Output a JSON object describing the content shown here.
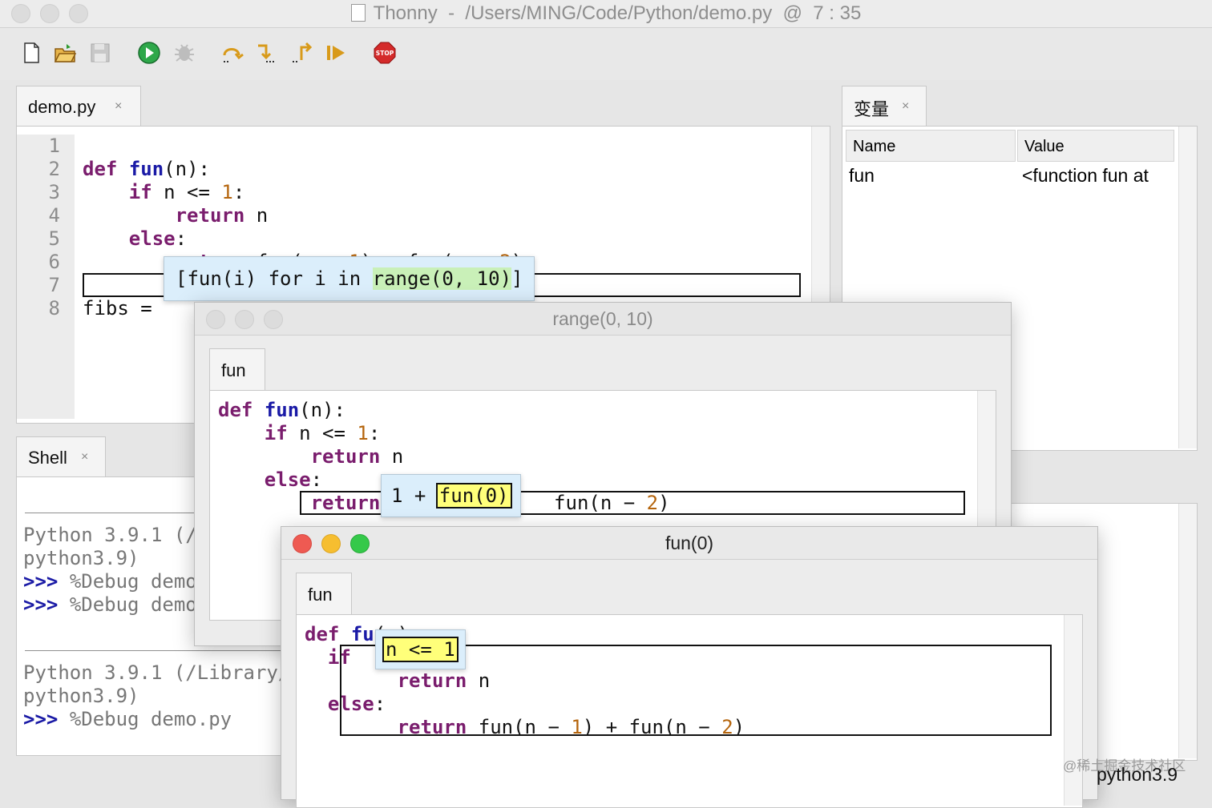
{
  "window": {
    "app": "Thonny",
    "path": "/Users/MING/Code/Python/demo.py",
    "cursor": "7 : 35"
  },
  "toolbar": [
    "new-icon",
    "open-icon",
    "save-icon",
    "run-icon",
    "debug-icon",
    "step-over-icon",
    "step-into-icon",
    "step-out-icon",
    "resume-icon",
    "stop-icon"
  ],
  "stop_label": "STOP",
  "editor": {
    "tab_label": "demo.py",
    "close_glyph": "×",
    "line_numbers": [
      "1",
      "2",
      "3",
      "4",
      "5",
      "6",
      "7",
      "8"
    ],
    "lines": {
      "l1": [
        "def",
        "fun",
        "(n):"
      ],
      "l2": [
        "if",
        " n <= ",
        "1",
        ":"
      ],
      "l3": [
        "return",
        " n"
      ],
      "l4": [
        "else",
        ":"
      ],
      "l5": [
        "return",
        " fun(n − ",
        "1",
        ") + fun(n − ",
        "2",
        ")"
      ],
      "l7": "fibs = "
    },
    "popup": [
      "[fun(i) for i in ",
      "range(0, 10)",
      "]"
    ]
  },
  "variables": {
    "tab_label": "变量",
    "close_glyph": "×",
    "col_name": "Name",
    "col_value": "Value",
    "rows": [
      {
        "name": "fun",
        "value": "<function fun at"
      }
    ]
  },
  "shell": {
    "tab_label": "Shell",
    "close_glyph": "×",
    "block1": [
      "Python 3.9.1 (/",
      "python3.9)"
    ],
    "cmd1": "%Debug demo",
    "cmd2": "%Debug demo",
    "block2": [
      "Python 3.9.1 (/Library/",
      "python3.9)"
    ],
    "cmd3": "%Debug demo.py",
    "prompt": ">>>"
  },
  "frame1": {
    "title": "range(0, 10)",
    "tab_label": "fun",
    "lines": {
      "l1": [
        "def",
        "fun",
        "(n):"
      ],
      "l2": [
        "if",
        " n <= ",
        "1",
        ":"
      ],
      "l3": [
        "return",
        " n"
      ],
      "l4": [
        "else",
        ":"
      ],
      "l5a": "return",
      "l5b": " fun(n − ",
      "l5c": "2",
      "l5d": ")"
    },
    "popup": [
      "1 + ",
      "fun(0)"
    ]
  },
  "frame2": {
    "title": "fun(0)",
    "tab_label": "fun",
    "lines": {
      "l1a": "def",
      "l1b": "fu",
      "l1c": "(n):",
      "l2": "if",
      "l3": [
        "return",
        " n"
      ],
      "l4": [
        "else",
        ":"
      ],
      "l5": [
        "return",
        " fun(n − ",
        "1",
        ") + fun(n − ",
        "2",
        ")"
      ]
    },
    "popup": "n <= 1"
  },
  "interpreter": "python3.9",
  "watermark": "@稀土掘金技术社区"
}
